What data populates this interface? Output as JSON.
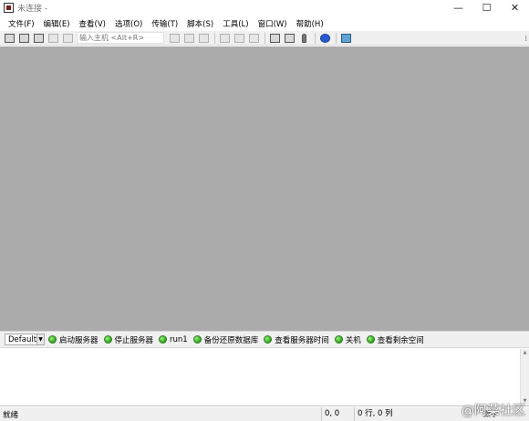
{
  "window": {
    "title": "未连接 -",
    "controls": {
      "minimize": "—",
      "maximize": "☐",
      "close": "✕"
    }
  },
  "menu": {
    "items": [
      "文件(F)",
      "编辑(E)",
      "查看(V)",
      "选项(O)",
      "传输(T)",
      "脚本(S)",
      "工具(L)",
      "窗口(W)",
      "帮助(H)"
    ]
  },
  "toolbar": {
    "host_placeholder": "输入主机 <Alt+R>",
    "icons_left": [
      "connect-icon",
      "quick-connect-icon",
      "connect-tab-icon",
      "reconnect-icon",
      "disconnect-icon"
    ],
    "icons_right": [
      "copy-icon",
      "paste-icon",
      "find-icon",
      "print-icon",
      "print-setup-icon",
      "print-screen-icon",
      "session-options-icon",
      "global-options-icon",
      "keymap-icon",
      "help-icon",
      "sftp-icon"
    ],
    "grip": "⁞"
  },
  "button_bar": {
    "session_selector": "Default",
    "buttons": [
      "启动服务器",
      "停止服务器",
      "run1",
      "备份还原数据库",
      "查看服务器时间",
      "关机",
      "查看剩余空间"
    ]
  },
  "status": {
    "ready": "就绪",
    "cursor_pos": "0, 0",
    "row_col": "0 行, 0 列",
    "num_lock": "数字"
  },
  "watermark": "@阿菜社区",
  "colors": {
    "workspace": "#ababab",
    "button_indicator": "#3fb52a"
  }
}
